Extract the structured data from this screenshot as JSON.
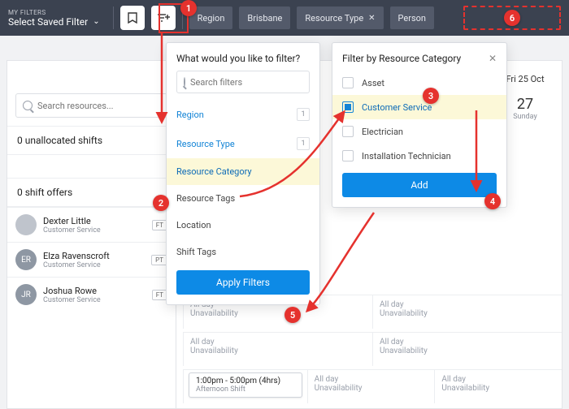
{
  "topbar": {
    "my_filters_label": "MY FILTERS",
    "saved_filter_label": "Select Saved Filter",
    "pills": [
      {
        "label": "Region",
        "closable": false
      },
      {
        "label": "Brisbane",
        "closable": false
      },
      {
        "label": "Resource Type",
        "closable": true
      },
      {
        "label": "Person",
        "closable": false
      }
    ]
  },
  "filter_popover": {
    "title": "What would you like to filter?",
    "search_placeholder": "Search filters",
    "items": [
      {
        "label": "Region",
        "count": "1",
        "link": true
      },
      {
        "label": "Resource Type",
        "count": "1",
        "link": true
      },
      {
        "label": "Resource Category",
        "highlight": true,
        "link": true
      },
      {
        "label": "Resource Tags"
      },
      {
        "label": "Location"
      },
      {
        "label": "Shift Tags"
      }
    ],
    "apply_label": "Apply Filters"
  },
  "category_popover": {
    "title": "Filter by Resource Category",
    "options": [
      {
        "label": "Asset",
        "checked": false
      },
      {
        "label": "Customer Service",
        "checked": true,
        "highlight": true
      },
      {
        "label": "Electrician",
        "checked": false
      },
      {
        "label": "Installation Technician",
        "checked": false
      }
    ],
    "add_label": "Add"
  },
  "left": {
    "search_placeholder": "Search resources...",
    "unallocated_label": "0 unallocated shifts",
    "offers_label": "0 shift offers",
    "people": [
      {
        "initials": "",
        "name": "Dexter Little",
        "role": "Customer Service",
        "badge": "FT",
        "avatar_bg": "#bfc4cc"
      },
      {
        "initials": "ER",
        "name": "Elza Ravenscroft",
        "role": "Customer Service",
        "badge": "PT",
        "avatar_bg": "#8e97a3"
      },
      {
        "initials": "JR",
        "name": "Joshua Rowe",
        "role": "Customer Service",
        "badge": "FT",
        "avatar_bg": "#8e97a3"
      }
    ]
  },
  "calendar": {
    "date_header": "Fri 25 Oct",
    "day_number": "27",
    "day_name": "Sunday",
    "allday_label": "All day",
    "unavail_label": "Unavailability",
    "shift": {
      "time": "1:00pm - 5:00pm (4hrs)",
      "name": "Afternoon Shift"
    }
  },
  "annotations": [
    "1",
    "2",
    "3",
    "4",
    "5",
    "6"
  ]
}
